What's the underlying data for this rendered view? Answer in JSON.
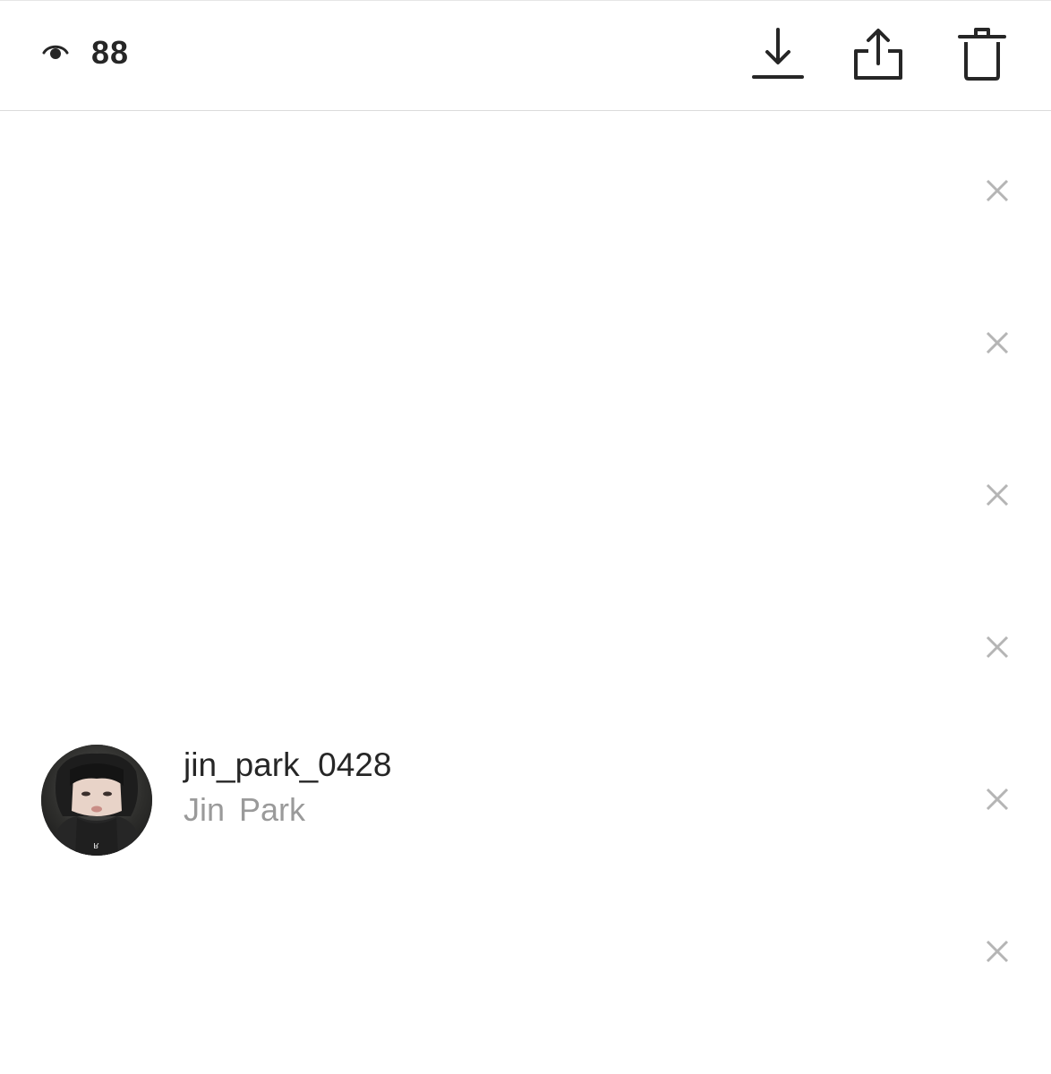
{
  "header": {
    "view_icon": "eye-icon",
    "view_count": "88",
    "actions": [
      {
        "name": "download",
        "icon": "download-icon"
      },
      {
        "name": "share",
        "icon": "share-icon"
      },
      {
        "name": "delete",
        "icon": "trash-icon"
      }
    ]
  },
  "viewers": [
    {
      "username": "",
      "full_name": ""
    },
    {
      "username": "",
      "full_name": ""
    },
    {
      "username": "",
      "full_name": ""
    },
    {
      "username": "",
      "full_name": ""
    },
    {
      "username": "jin_park_0428",
      "full_name": "Jin  Park",
      "avatar": "avatar-photo"
    },
    {
      "username": "",
      "full_name": ""
    }
  ],
  "colors": {
    "text_primary": "#262626",
    "text_secondary": "#9a9a9a",
    "close_icon": "#b5b5b5",
    "divider": "#dbdbdb"
  }
}
